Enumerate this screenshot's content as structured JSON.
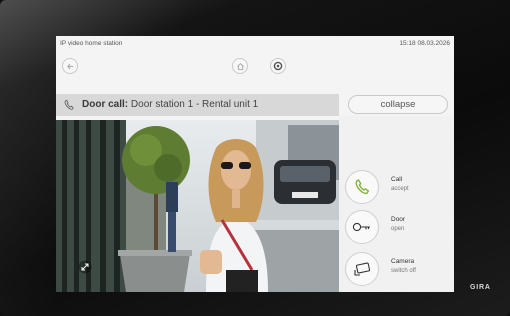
{
  "device": {
    "brand": "GIRA"
  },
  "status_bar": {
    "title": "IP video home station",
    "clock": "15:18 08.03.2026"
  },
  "nav": {
    "back_icon": "arrow-left-icon",
    "home_icon": "home-icon",
    "settings_icon": "settings-icon"
  },
  "call": {
    "prefix": "Door call:",
    "source": "Door station 1 - Rental unit 1",
    "icon": "handset-icon"
  },
  "collapse_label": "collapse",
  "video": {
    "expand_icon": "expand-icon"
  },
  "actions": [
    {
      "label": "Call",
      "sub": "accept",
      "icon": "handset-icon",
      "color": "#7bb23a"
    },
    {
      "label": "Door",
      "sub": "open",
      "icon": "key-icon",
      "color": "#333333"
    },
    {
      "label": "Camera",
      "sub": "switch off",
      "icon": "camera-icon",
      "color": "#333333"
    }
  ]
}
